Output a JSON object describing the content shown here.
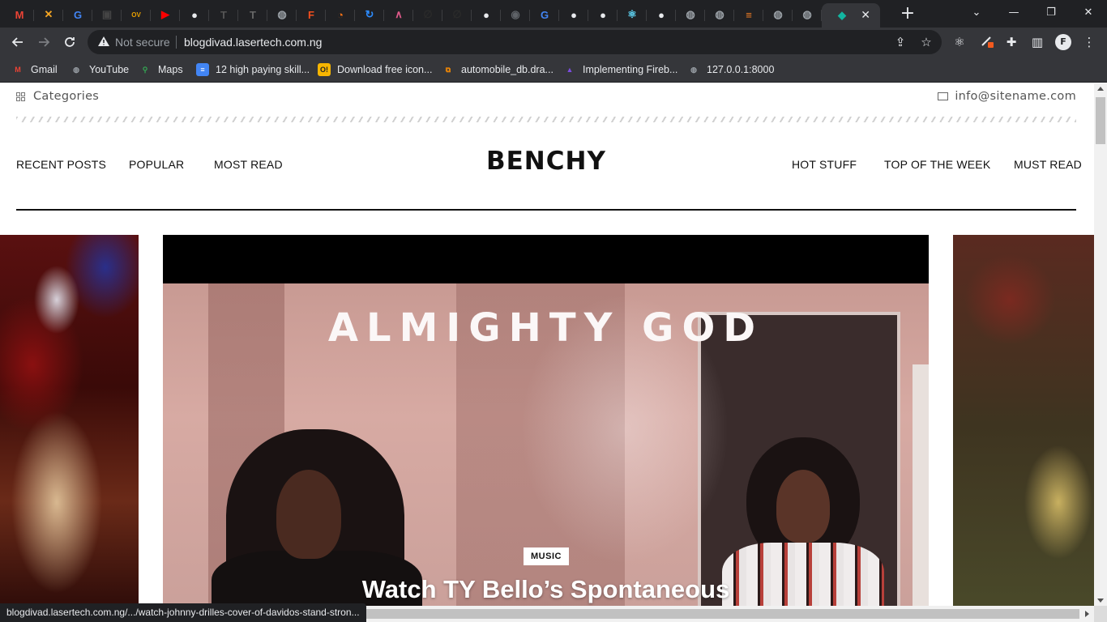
{
  "browser": {
    "tabs": [
      {
        "icon": "gmail-icon",
        "glyph": "M",
        "color": "#ea4335"
      },
      {
        "icon": "crossed-tools-icon",
        "glyph": "✕",
        "color": "#f5a623"
      },
      {
        "icon": "google-icon",
        "glyph": "G",
        "color": "#4285f4"
      },
      {
        "icon": "app-icon",
        "glyph": "▣",
        "color": "#444444"
      },
      {
        "icon": "ov-icon",
        "glyph": "OV",
        "color": "#e8a000"
      },
      {
        "icon": "youtube-icon",
        "glyph": "▶",
        "color": "#ff0000"
      },
      {
        "icon": "github-icon",
        "glyph": "●",
        "color": "#e8eaed"
      },
      {
        "icon": "t-icon",
        "glyph": "T",
        "color": "#555555"
      },
      {
        "icon": "t-icon",
        "glyph": "T",
        "color": "#666666"
      },
      {
        "icon": "globe-icon",
        "glyph": "◍",
        "color": "#9aa0a6"
      },
      {
        "icon": "figma-icon",
        "glyph": "F",
        "color": "#f24e1e"
      },
      {
        "icon": "loader-icon",
        "glyph": "◔",
        "color": "#f97316"
      },
      {
        "icon": "sync-icon",
        "glyph": "↻",
        "color": "#2d8cff"
      },
      {
        "icon": "wave-icon",
        "glyph": "∧",
        "color": "#e05a8a"
      },
      {
        "icon": "link-icon",
        "glyph": "∅",
        "color": "#2a2a2a"
      },
      {
        "icon": "link-icon",
        "glyph": "∅",
        "color": "#2a2a2a"
      },
      {
        "icon": "github-icon",
        "glyph": "●",
        "color": "#e8eaed"
      },
      {
        "icon": "eye-icon",
        "glyph": "◉",
        "color": "#5f6368"
      },
      {
        "icon": "google-icon",
        "glyph": "G",
        "color": "#4285f4"
      },
      {
        "icon": "github-icon",
        "glyph": "●",
        "color": "#e8eaed"
      },
      {
        "icon": "github-icon",
        "glyph": "●",
        "color": "#e8eaed"
      },
      {
        "icon": "react-icon",
        "glyph": "⚛",
        "color": "#61dafb"
      },
      {
        "icon": "github-icon",
        "glyph": "●",
        "color": "#e8eaed"
      },
      {
        "icon": "globe-icon",
        "glyph": "◍",
        "color": "#9aa0a6"
      },
      {
        "icon": "globe-icon",
        "glyph": "◍",
        "color": "#9aa0a6"
      },
      {
        "icon": "stackoverflow-icon",
        "glyph": "≡",
        "color": "#f48024"
      },
      {
        "icon": "globe-icon",
        "glyph": "◍",
        "color": "#9aa0a6"
      },
      {
        "icon": "globe-icon",
        "glyph": "◍",
        "color": "#9aa0a6"
      },
      {
        "icon": "diamond-icon",
        "glyph": "◆",
        "color": "#12b5a0"
      }
    ],
    "new_tab_label": "+",
    "window_controls": {
      "dropdown": "⌄",
      "minimize": "—",
      "restore": "❐",
      "close": "✕"
    },
    "toolbar": {
      "security_label": "Not secure",
      "url": "blogdivad.lasertech.com.ng"
    },
    "bookmarks": [
      {
        "label": "Gmail",
        "icon": "gmail-icon",
        "glyph": "M",
        "color": "#ea4335"
      },
      {
        "label": "YouTube",
        "icon": "globe-icon",
        "glyph": "◍",
        "color": "#9aa0a6"
      },
      {
        "label": "Maps",
        "icon": "maps-icon",
        "glyph": "⚲",
        "color": "#34a853"
      },
      {
        "label": "12 high paying skill...",
        "icon": "docs-icon",
        "glyph": "≡",
        "color": "#4285f4"
      },
      {
        "label": "Download free icon...",
        "icon": "icon-site-icon",
        "glyph": "O!",
        "color": "#f7b500"
      },
      {
        "label": "automobile_db.dra...",
        "icon": "drawio-icon",
        "glyph": "⧉",
        "color": "#f08705"
      },
      {
        "label": "Implementing Fireb...",
        "icon": "rocket-icon",
        "glyph": "▲",
        "color": "#7b4ce0"
      },
      {
        "label": "127.0.0.1:8000",
        "icon": "globe-icon",
        "glyph": "◍",
        "color": "#9aa0a6"
      }
    ]
  },
  "site": {
    "topbar": {
      "categories_label": "Categories",
      "email": "info@sitename.com"
    },
    "nav_left": [
      "RECENT POSTS",
      "POPULAR",
      "MOST READ"
    ],
    "logo": "BENCHY",
    "nav_right": [
      "HOT STUFF",
      "TOP OF THE WEEK",
      "MUST READ"
    ],
    "hero": {
      "overlay_text": "ALMIGHTY GOD",
      "category": "MUSIC",
      "title": "Watch TY Bello’s Spontaneous"
    }
  },
  "status_url": "blogdivad.lasertech.com.ng/.../watch-johnny-drilles-cover-of-davidos-stand-stron..."
}
